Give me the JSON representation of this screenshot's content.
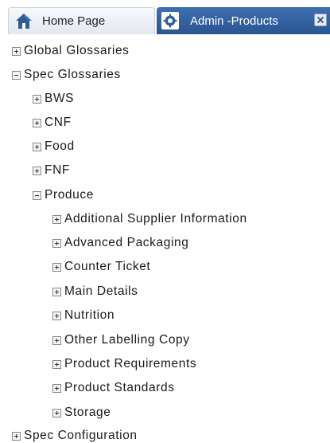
{
  "tabs": [
    {
      "label": "Home Page",
      "icon": "home-icon",
      "active": false
    },
    {
      "label": "Admin -Products",
      "icon": "gear-icon",
      "active": true,
      "close_icon": "close-icon"
    }
  ],
  "colors": {
    "active_tab": "#2f5f9e",
    "inactive_tab": "#e6ebf1",
    "text": "#1a1a1a"
  },
  "tree": {
    "items": [
      {
        "label": "Global Glossaries",
        "state": "collapsed"
      },
      {
        "label": "Spec Glossaries",
        "state": "expanded"
      },
      {
        "label": "BWS",
        "state": "collapsed"
      },
      {
        "label": "CNF",
        "state": "collapsed"
      },
      {
        "label": "Food",
        "state": "collapsed"
      },
      {
        "label": "FNF",
        "state": "collapsed"
      },
      {
        "label": "Produce",
        "state": "expanded"
      },
      {
        "label": "Additional Supplier Information",
        "state": "collapsed"
      },
      {
        "label": "Advanced Packaging",
        "state": "collapsed"
      },
      {
        "label": "Counter Ticket",
        "state": "collapsed"
      },
      {
        "label": "Main Details",
        "state": "collapsed"
      },
      {
        "label": "Nutrition",
        "state": "collapsed"
      },
      {
        "label": "Other Labelling Copy",
        "state": "collapsed"
      },
      {
        "label": "Product Requirements",
        "state": "collapsed"
      },
      {
        "label": "Product Standards",
        "state": "collapsed"
      },
      {
        "label": "Storage",
        "state": "collapsed"
      },
      {
        "label": "Spec Configuration",
        "state": "collapsed"
      }
    ]
  }
}
